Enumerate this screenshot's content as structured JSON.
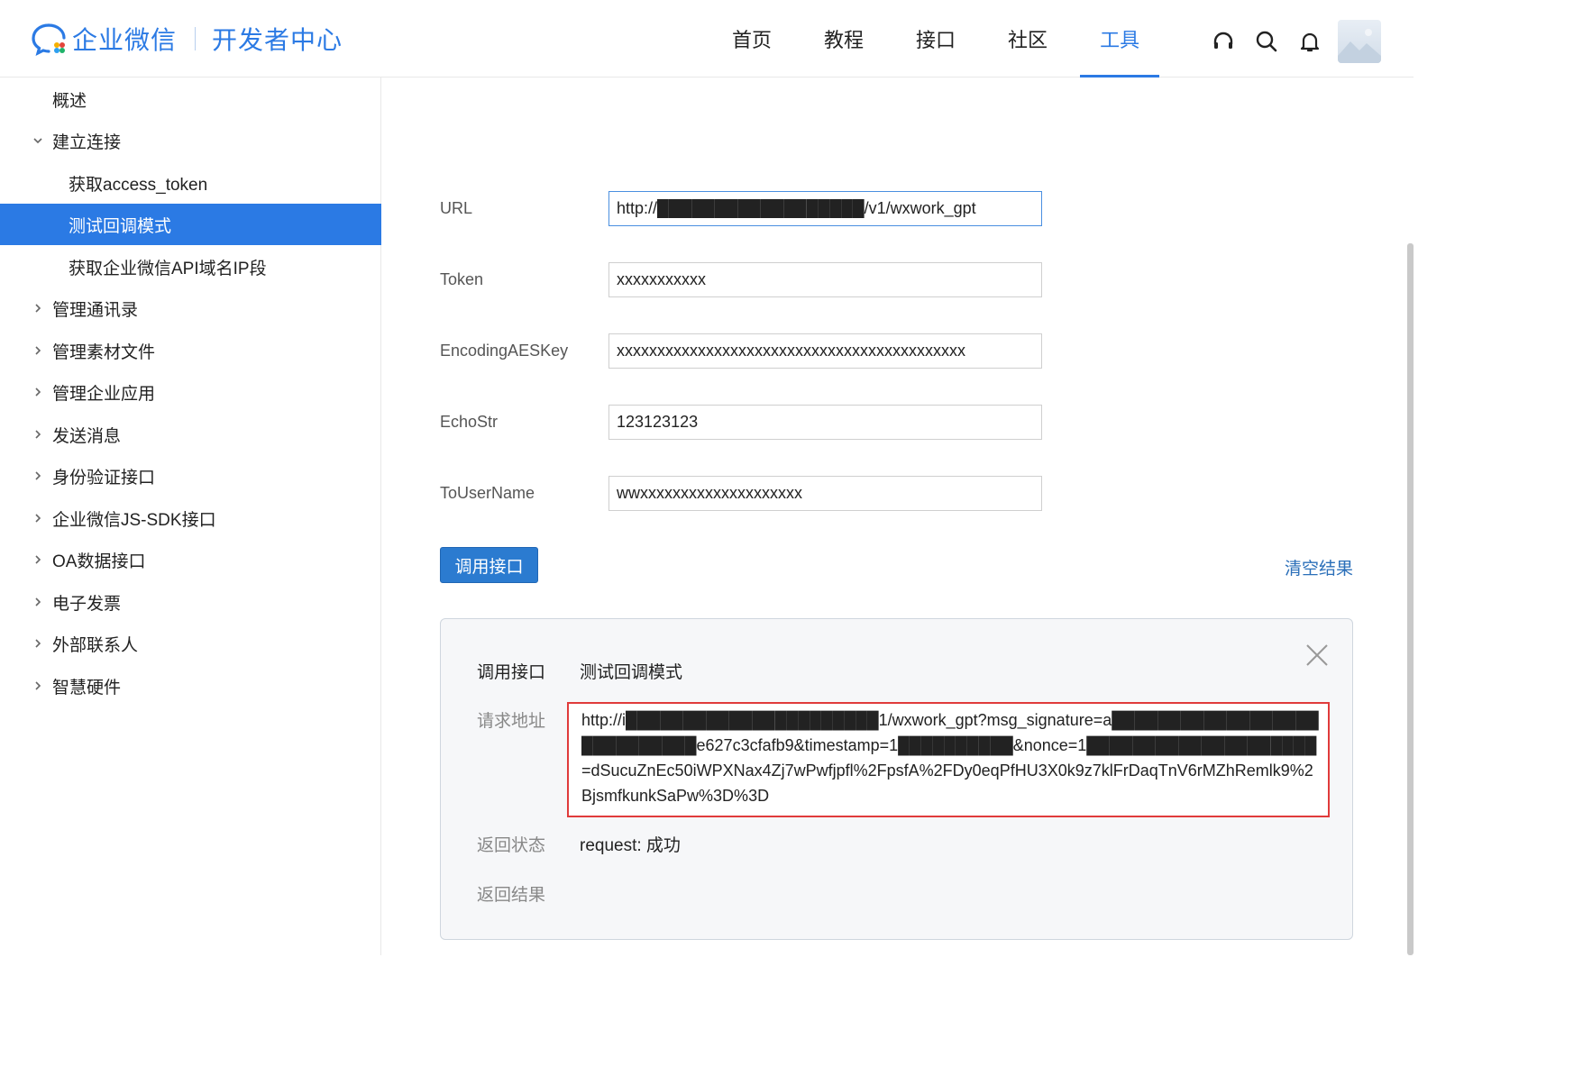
{
  "header": {
    "logo_text": "企业微信",
    "logo_sub": "开发者中心",
    "nav": [
      {
        "label": "首页"
      },
      {
        "label": "教程"
      },
      {
        "label": "接口"
      },
      {
        "label": "社区"
      },
      {
        "label": "工具",
        "active": true
      }
    ],
    "icons": [
      "headset-icon",
      "search-icon",
      "bell-icon"
    ],
    "accent_color": "#2b7ae4"
  },
  "sidebar": {
    "items": [
      {
        "label": "概述",
        "level": 1,
        "expandable": false
      },
      {
        "label": "建立连接",
        "level": 1,
        "expandable": true,
        "expanded": true
      },
      {
        "label": "获取access_token",
        "level": 2
      },
      {
        "label": "测试回调模式",
        "level": 2,
        "active": true
      },
      {
        "label": "获取企业微信API域名IP段",
        "level": 2
      },
      {
        "label": "管理通讯录",
        "level": 1,
        "expandable": true
      },
      {
        "label": "管理素材文件",
        "level": 1,
        "expandable": true
      },
      {
        "label": "管理企业应用",
        "level": 1,
        "expandable": true
      },
      {
        "label": "发送消息",
        "level": 1,
        "expandable": true
      },
      {
        "label": "身份验证接口",
        "level": 1,
        "expandable": true
      },
      {
        "label": "企业微信JS-SDK接口",
        "level": 1,
        "expandable": true
      },
      {
        "label": "OA数据接口",
        "level": 1,
        "expandable": true
      },
      {
        "label": "电子发票",
        "level": 1,
        "expandable": true
      },
      {
        "label": "外部联系人",
        "level": 1,
        "expandable": true
      },
      {
        "label": "智慧硬件",
        "level": 1,
        "expandable": true
      }
    ]
  },
  "form": {
    "fields": [
      {
        "label": "URL",
        "value": "http://██████████████████/v1/wxwork_gpt"
      },
      {
        "label": "Token",
        "value": "xxxxxxxxxxx"
      },
      {
        "label": "EncodingAESKey",
        "value": "xxxxxxxxxxxxxxxxxxxxxxxxxxxxxxxxxxxxxxxxxxx"
      },
      {
        "label": "EchoStr",
        "value": "123123123"
      },
      {
        "label": "ToUserName",
        "value": "wwxxxxxxxxxxxxxxxxxxxx"
      }
    ],
    "call_button": "调用接口",
    "clear_link": "清空结果"
  },
  "result": {
    "call_label": "调用接口",
    "call_value": "测试回调模式",
    "address_label": "请求地址",
    "address_value": "http://i██████████████████████1/wxwork_gpt?msg_signature=a████████████████████████████e627c3cfafb9&timestamp=1██████████&nonce=1████████████████████=dSucuZnEc50iWPXNax4Zj7wPwfjpfl%2FpsfA%2FDy0eqPfHU3X0k9z7klFrDaqTnV6rMZhRemlk9%2BjsmfkunkSaPw%3D%3D",
    "status_label": "返回状态",
    "status_value": "request: 成功",
    "result_label": "返回结果",
    "result_value": "",
    "highlight_color": "#e03b3b"
  }
}
